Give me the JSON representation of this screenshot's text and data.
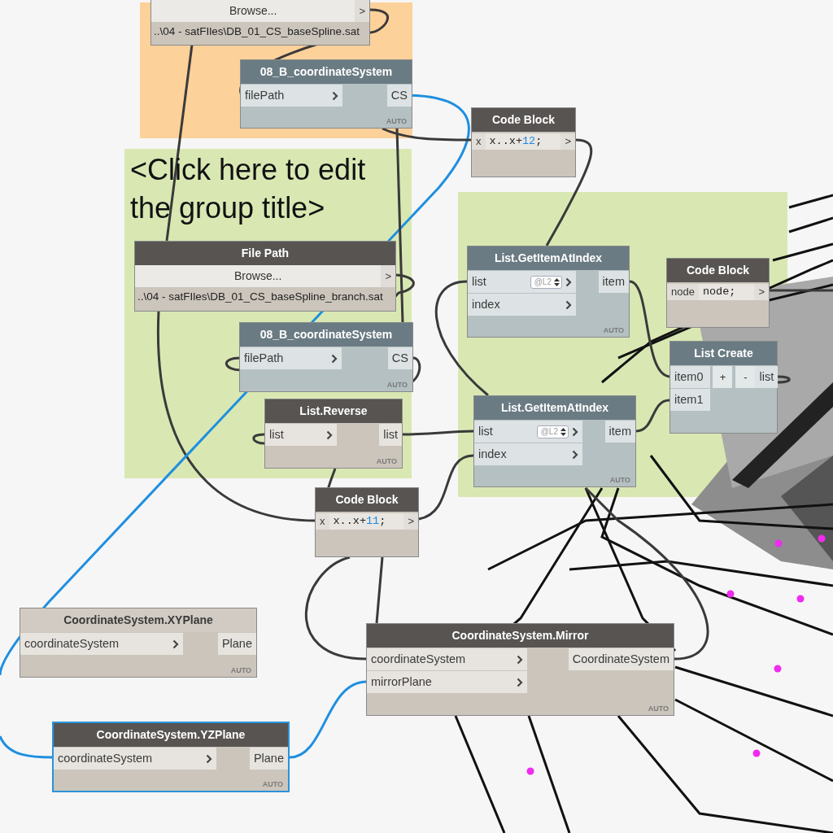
{
  "groups": [
    {
      "color": "#fdd19a"
    },
    {
      "color": "#d9e8b3",
      "title": "<Click here to edit the group title>"
    },
    {
      "color": "#d9e8b3"
    }
  ],
  "nodes": [
    {
      "kind": "file_path",
      "selected": false,
      "button": "Browse...",
      "outputs": [
        ">"
      ],
      "path": "..\\04 - satFIles\\DB_01_CS_baseSpline.sat"
    },
    {
      "kind": "custom",
      "preview": true,
      "selected": false,
      "title": "08_B_coordinateSystem",
      "inputs": [
        {
          "name": "filePath"
        }
      ],
      "outputs": [
        "CS"
      ],
      "lacing": "AUTO"
    },
    {
      "kind": "code_block",
      "preview": true,
      "selected": false,
      "title": "Code Block",
      "inputs": [
        {
          "name": "x"
        }
      ],
      "code": [
        {
          "text": "x..x+",
          "kind": "plain"
        },
        {
          "text": "12",
          "kind": "number"
        },
        {
          "text": ";",
          "kind": "plain"
        }
      ],
      "outputs": [
        ">"
      ]
    },
    {
      "kind": "file_path",
      "preview": true,
      "selected": false,
      "title": "File Path",
      "button": "Browse...",
      "outputs": [
        ">"
      ],
      "path": "..\\04 - satFIles\\DB_01_CS_baseSpline_branch.sat"
    },
    {
      "kind": "custom",
      "preview": true,
      "selected": false,
      "title": "08_B_coordinateSystem",
      "inputs": [
        {
          "name": "filePath"
        }
      ],
      "outputs": [
        "CS"
      ],
      "lacing": "AUTO"
    },
    {
      "kind": "function",
      "preview": true,
      "selected": false,
      "title": "List.Reverse",
      "inputs": [
        {
          "name": "list"
        }
      ],
      "outputs": [
        "list"
      ],
      "lacing": "AUTO"
    },
    {
      "kind": "code_block",
      "preview": true,
      "selected": false,
      "title": "Code Block",
      "inputs": [
        {
          "name": "x"
        }
      ],
      "code": [
        {
          "text": "x..x+",
          "kind": "plain"
        },
        {
          "text": "11",
          "kind": "number"
        },
        {
          "text": ";",
          "kind": "plain"
        }
      ],
      "outputs": [
        ">"
      ]
    },
    {
      "kind": "custom",
      "preview": true,
      "selected": false,
      "title": "List.GetItemAtIndex",
      "inputs": [
        {
          "name": "list",
          "level": "@L2"
        },
        {
          "name": "index"
        }
      ],
      "outputs": [
        "item"
      ],
      "lacing": "AUTO"
    },
    {
      "kind": "custom",
      "preview": true,
      "selected": false,
      "title": "List.GetItemAtIndex",
      "inputs": [
        {
          "name": "list",
          "level": "@L2"
        },
        {
          "name": "index"
        }
      ],
      "outputs": [
        "item"
      ],
      "lacing": "AUTO"
    },
    {
      "kind": "code_block",
      "preview": true,
      "selected": false,
      "title": "Code Block",
      "inputs": [
        {
          "name": "node"
        }
      ],
      "code": [
        {
          "text": "node;",
          "kind": "plain"
        }
      ],
      "outputs": [
        ">"
      ]
    },
    {
      "kind": "custom",
      "preview": true,
      "selected": false,
      "title": "List Create",
      "inputs": [
        {
          "name": "item0"
        },
        {
          "name": "item1"
        }
      ],
      "buttons": [
        "+",
        "-"
      ],
      "outputs": [
        "list"
      ]
    },
    {
      "kind": "function",
      "preview": false,
      "selected": false,
      "title": "CoordinateSystem.XYPlane",
      "inputs": [
        {
          "name": "coordinateSystem"
        }
      ],
      "outputs": [
        "Plane"
      ],
      "lacing": "AUTO"
    },
    {
      "kind": "function",
      "preview": true,
      "selected": false,
      "title": "CoordinateSystem.Mirror",
      "inputs": [
        {
          "name": "coordinateSystem"
        },
        {
          "name": "mirrorPlane"
        }
      ],
      "outputs": [
        "CoordinateSystem"
      ],
      "lacing": "AUTO"
    },
    {
      "kind": "function",
      "preview": true,
      "selected": true,
      "title": "CoordinateSystem.YZPlane",
      "inputs": [
        {
          "name": "coordinateSystem"
        }
      ],
      "outputs": [
        "Plane"
      ],
      "lacing": "AUTO"
    }
  ]
}
